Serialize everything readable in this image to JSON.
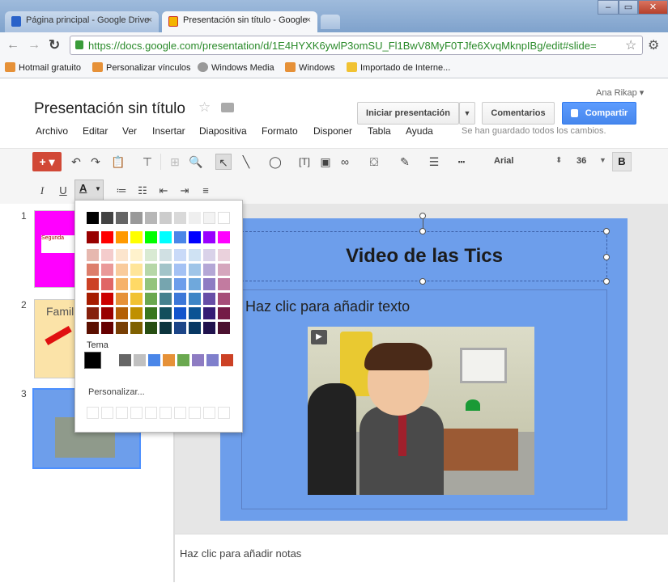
{
  "browser": {
    "tabs": [
      {
        "label": "Página principal - Google Drive",
        "close": "×"
      },
      {
        "label": "Presentación sin título - Google",
        "close": "×"
      }
    ],
    "url": "https://docs.google.com/presentation/d/1E4HYXK6ywlP3omSU_Fl1BwV8MyF0TJfe6XvqMknpIBg/edit#slide=",
    "bookmarks": [
      "Hotmail gratuito",
      "Personalizar vínculos",
      "Windows Media",
      "Windows",
      "Importado de Interne..."
    ],
    "window_buttons": [
      "‒",
      "▭",
      "✕"
    ]
  },
  "docs": {
    "title": "Presentación sin título",
    "user": "Ana Rikap ▾",
    "menus": [
      "Archivo",
      "Editar",
      "Ver",
      "Insertar",
      "Diapositiva",
      "Formato",
      "Disponer",
      "Tabla",
      "Ayuda"
    ],
    "save_status": "Se han guardado todos los cambios.",
    "present_button": "Iniciar presentación",
    "comments_button": "Comentarios",
    "share_button": "Compartir",
    "font_name": "Arial",
    "font_size": "36",
    "bold_label": "B",
    "italic_label": "I",
    "underline_label": "U",
    "text_color_label": "A"
  },
  "filmstrip": {
    "slides": [
      {
        "number": "1",
        "thumb_text": "Segunda"
      },
      {
        "number": "2",
        "thumb_text": "Famil"
      },
      {
        "number": "3"
      }
    ]
  },
  "slide": {
    "title": "Video de las Tics",
    "body_placeholder": "Haz clic para añadir texto"
  },
  "notes": {
    "placeholder": "Haz clic para añadir notas"
  },
  "color_picker": {
    "grays": [
      "#000000",
      "#434343",
      "#666666",
      "#999999",
      "#b7b7b7",
      "#cccccc",
      "#d9d9d9",
      "#efefef",
      "#f3f3f3",
      "#ffffff"
    ],
    "brights": [
      "#980000",
      "#ff0000",
      "#ff9900",
      "#ffff00",
      "#00ff00",
      "#00ffff",
      "#4a86e8",
      "#0000ff",
      "#9900ff",
      "#ff00ff"
    ],
    "shades": [
      [
        "#e6b8af",
        "#f4cccc",
        "#fce5cd",
        "#fff2cc",
        "#d9ead3",
        "#d0e0e3",
        "#c9daf8",
        "#cfe2f3",
        "#d9d2e9",
        "#ead1dc"
      ],
      [
        "#dd7e6b",
        "#ea9999",
        "#f9cb9c",
        "#ffe599",
        "#b6d7a8",
        "#a2c4c9",
        "#a4c2f4",
        "#9fc5e8",
        "#b4a7d6",
        "#d5a6bd"
      ],
      [
        "#cc4125",
        "#e06666",
        "#f6b26b",
        "#ffd966",
        "#93c47d",
        "#76a5af",
        "#6d9eeb",
        "#6fa8dc",
        "#8e7cc3",
        "#c27ba0"
      ],
      [
        "#a61c00",
        "#cc0000",
        "#e69138",
        "#f1c232",
        "#6aa84f",
        "#45818e",
        "#3c78d8",
        "#3d85c6",
        "#674ea7",
        "#a64d79"
      ],
      [
        "#85200c",
        "#990000",
        "#b45f06",
        "#bf9000",
        "#38761d",
        "#134f5c",
        "#1155cc",
        "#0b5394",
        "#351c75",
        "#741b47"
      ],
      [
        "#5b0f00",
        "#660000",
        "#783f04",
        "#7f6000",
        "#274e13",
        "#0c343d",
        "#1c4587",
        "#073763",
        "#20124d",
        "#4c1130"
      ]
    ],
    "theme_label": "Tema",
    "theme": [
      "#000000",
      "#666666",
      "#c0c0c0",
      "#4a86e8",
      "#e69138",
      "#6aa84f",
      "#8e7cc3",
      "#7f7fcc",
      "#cc4125"
    ],
    "custom_label": "Personalizar...",
    "colors": {
      "accent": "#4d90fe",
      "slide_bg": "#6d9eeb",
      "new_button": "#d14836",
      "thumb1_bg": "#ff00ff"
    }
  }
}
